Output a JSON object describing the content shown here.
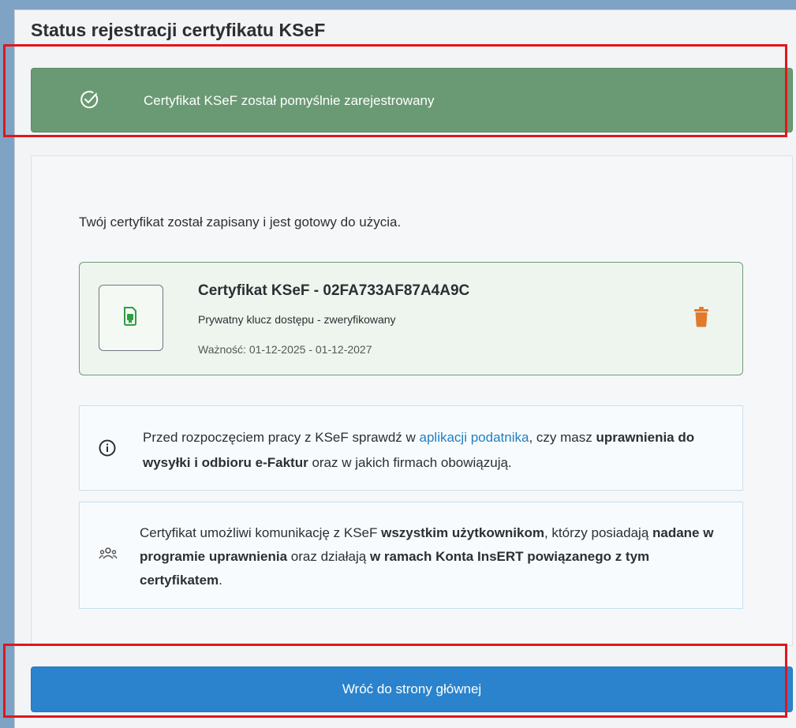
{
  "dialog": {
    "title": "Status rejestracji certyfikatu KSeF"
  },
  "banner": {
    "icon": "check-circle-icon",
    "message": "Certyfikat KSeF został pomyślnie zarejestrowany",
    "color": "#6a9a73"
  },
  "content": {
    "intro": "Twój certyfikat został zapisany i jest gotowy do użycia."
  },
  "certificate": {
    "icon": "certificate-file-icon",
    "title": "Certyfikat KSeF - 02FA733AF87A4A9C",
    "key_status": "Prywatny klucz dostępu - zweryfikowany",
    "validity": "Ważność: 01-12-2025 - 01-12-2027",
    "delete_icon": "trash-icon",
    "delete_color": "#e07a2c"
  },
  "info": {
    "icon": "info-icon",
    "part1": "Przed rozpoczęciem pracy z KSeF sprawdź w ",
    "link": "aplikacji podatnika",
    "part2": ", czy masz ",
    "bold1": "uprawnienia do wysyłki i odbioru e-Faktur",
    "part3": " oraz w jakich firmach obowiązują."
  },
  "users_note": {
    "icon": "users-icon",
    "part1": "Certyfikat umożliwi komunikację z KSeF ",
    "bold1": "wszystkim użytkownikom",
    "part2": ", którzy posiadają ",
    "bold2": "nadane w programie uprawnienia",
    "part3": " oraz działają ",
    "bold3": "w ramach Konta InsERT powiązanego z tym certyfikatem",
    "part4": "."
  },
  "footer": {
    "button_label": "Wróć do strony głównej",
    "button_color": "#2a83cc"
  }
}
